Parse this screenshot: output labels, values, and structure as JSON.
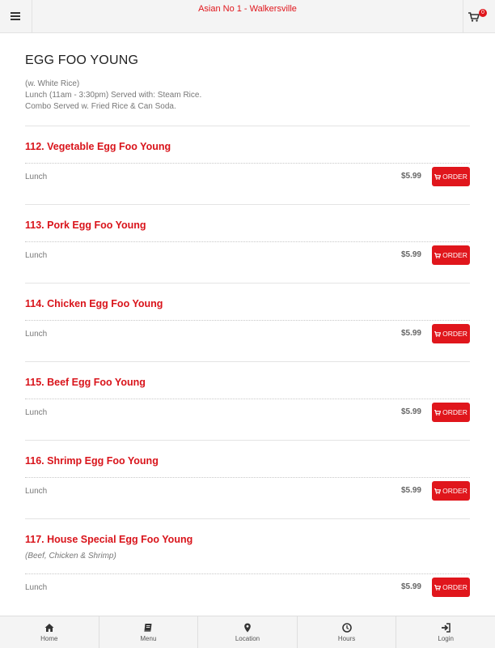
{
  "header": {
    "title": "Asian No 1 - Walkersville",
    "cart_count": "0"
  },
  "section": {
    "title": "EGG FOO YOUNG",
    "description": [
      "(w. White Rice)",
      "Lunch (11am - 3:30pm) Served with: Steam Rice.",
      "Combo Served w. Fried Rice & Can Soda."
    ]
  },
  "items": [
    {
      "name": "112. Vegetable Egg Foo Young",
      "note": "",
      "price_label": "Lunch",
      "price": "$5.99",
      "order_label": "ORDER"
    },
    {
      "name": "113. Pork Egg Foo Young",
      "note": "",
      "price_label": "Lunch",
      "price": "$5.99",
      "order_label": "ORDER"
    },
    {
      "name": "114. Chicken Egg Foo Young",
      "note": "",
      "price_label": "Lunch",
      "price": "$5.99",
      "order_label": "ORDER"
    },
    {
      "name": "115. Beef Egg Foo Young",
      "note": "",
      "price_label": "Lunch",
      "price": "$5.99",
      "order_label": "ORDER"
    },
    {
      "name": "116. Shrimp Egg Foo Young",
      "note": "",
      "price_label": "Lunch",
      "price": "$5.99",
      "order_label": "ORDER"
    },
    {
      "name": "117. House Special Egg Foo Young",
      "note": "(Beef, Chicken & Shrimp)",
      "price_label": "Lunch",
      "price": "$5.99",
      "order_label": "ORDER"
    }
  ],
  "bottom_nav": [
    {
      "label": "Home",
      "icon": "home-icon"
    },
    {
      "label": "Menu",
      "icon": "book-icon"
    },
    {
      "label": "Location",
      "icon": "map-pin-icon"
    },
    {
      "label": "Hours",
      "icon": "clock-icon"
    },
    {
      "label": "Login",
      "icon": "login-icon"
    }
  ],
  "colors": {
    "accent": "#e0161c",
    "header_bg": "#f4f4f4"
  }
}
